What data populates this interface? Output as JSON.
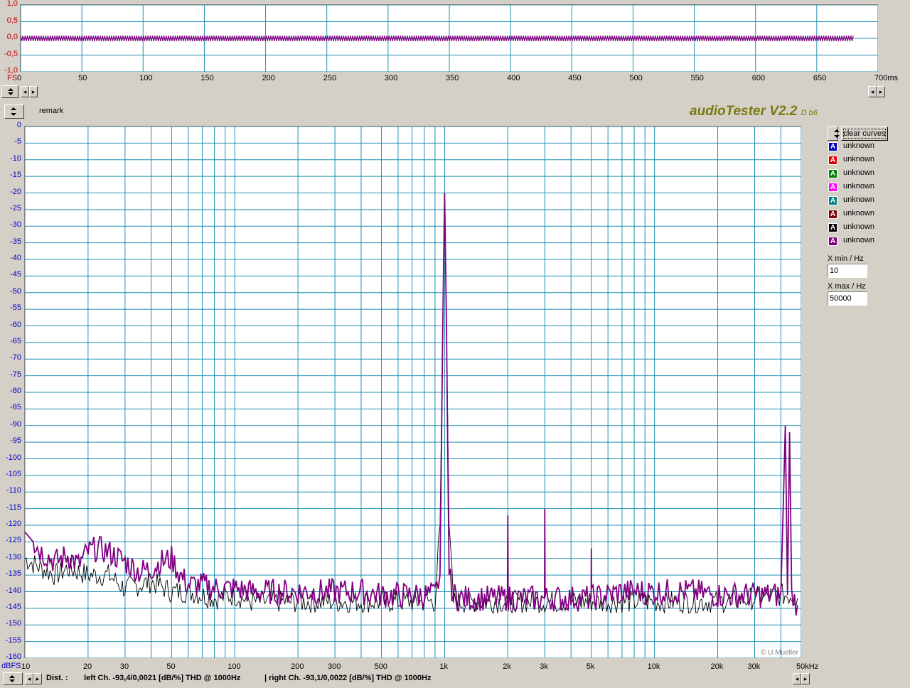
{
  "app": {
    "title": "audioTester V2.2",
    "version_suffix": "D b6",
    "remark": "remark",
    "copyright": "© U.Mueller",
    "clear_button": "clear curves"
  },
  "scope": {
    "y_ticks": [
      "1,0",
      "0,5",
      "0,0",
      "-0,5",
      "-1,0"
    ],
    "y_unit": "FS",
    "x_ticks": [
      "0",
      "50",
      "100",
      "150",
      "200",
      "250",
      "300",
      "350",
      "400",
      "450",
      "500",
      "550",
      "600",
      "650",
      "700ms"
    ]
  },
  "legend": {
    "items": [
      {
        "label": "unknown",
        "color": "#0000c0"
      },
      {
        "label": "unknown",
        "color": "#e00000"
      },
      {
        "label": "unknown",
        "color": "#008000"
      },
      {
        "label": "unknown",
        "color": "#ff00ff"
      },
      {
        "label": "unknown",
        "color": "#008080"
      },
      {
        "label": "unknown",
        "color": "#800000"
      },
      {
        "label": "unknown",
        "color": "#000000"
      },
      {
        "label": "unknown",
        "color": "#800080"
      }
    ],
    "swatch_glyph": "A"
  },
  "controls": {
    "xmin_label": "X min / Hz",
    "xmin_value": "10",
    "xmax_label": "X max / Hz",
    "xmax_value": "50000"
  },
  "status": {
    "dist_label": "Dist. :",
    "left": "left Ch. -93,4/0,0021 [dB/%] THD @ 1000Hz",
    "right": "| right Ch. -93,1/0,0022 [dB/%] THD @ 1000Hz"
  },
  "chart_data": [
    {
      "type": "line",
      "title": "",
      "xlabel": "ms",
      "ylabel": "FS",
      "xlim": [
        0,
        700
      ],
      "ylim": [
        -1,
        1
      ],
      "grid": true,
      "series": [
        {
          "color": "#800080",
          "x": [
            0,
            680
          ],
          "y": [
            0.0,
            0.0
          ],
          "amplitude": 0.08
        }
      ]
    },
    {
      "type": "line",
      "title": "",
      "xlabel": "kHz",
      "ylabel": "dBFS",
      "x_scale": "log",
      "xlim": [
        10,
        50000
      ],
      "ylim": [
        -160,
        0
      ],
      "grid": true,
      "y_ticks": [
        0,
        -5,
        -10,
        -15,
        -20,
        -25,
        -30,
        -35,
        -40,
        -45,
        -50,
        -55,
        -60,
        -65,
        -70,
        -75,
        -80,
        -85,
        -90,
        -95,
        -100,
        -105,
        -110,
        -115,
        -120,
        -125,
        -130,
        -135,
        -140,
        -145,
        -150,
        -155,
        -160
      ],
      "y_tick_labels": [
        "0",
        "-5",
        "-10",
        "-15",
        "-20",
        "-25",
        "-30",
        "-35",
        "-40",
        "-45",
        "-50",
        "-55",
        "-60",
        "-65",
        "-70",
        "-75",
        "-80",
        "-85",
        "-90",
        "-95",
        "-100",
        "-105",
        "-110",
        "-115",
        "-120",
        "-125",
        "-130",
        "-135",
        "-140",
        "-145",
        "-150",
        "-155",
        "-160"
      ],
      "y_unit": "dBFS",
      "x_ticks": [
        10,
        20,
        30,
        50,
        100,
        200,
        300,
        500,
        1000,
        2000,
        3000,
        5000,
        10000,
        20000,
        30000,
        50000
      ],
      "x_tick_labels": [
        "10",
        "20",
        "30",
        "50",
        "100",
        "200",
        "300",
        "500",
        "1k",
        "2k",
        "3k",
        "5k",
        "10k",
        "20k",
        "30k",
        "50kHz"
      ],
      "series": [
        {
          "color": "#000000",
          "x": [
            10,
            12,
            14,
            16,
            18,
            20,
            25,
            30,
            35,
            40,
            50,
            60,
            70,
            80,
            100,
            120,
            150,
            200,
            300,
            400,
            500,
            600,
            700,
            800,
            900,
            950,
            1000,
            1050,
            1100,
            1200,
            1500,
            2000,
            3000,
            4000,
            5000,
            7000,
            10000,
            15000,
            20000,
            30000,
            40000,
            45000,
            48000
          ],
          "y": [
            -130,
            -133,
            -135,
            -133,
            -134,
            -135,
            -135,
            -139,
            -138,
            -137,
            -140,
            -140,
            -141,
            -142,
            -141,
            -143,
            -143,
            -143,
            -143,
            -143,
            -143,
            -143,
            -143,
            -143,
            -143,
            -120,
            -20,
            -120,
            -143,
            -143,
            -143,
            -143,
            -143,
            -143,
            -143,
            -143,
            -143,
            -143,
            -143,
            -142,
            -141,
            -141,
            -142
          ]
        },
        {
          "color": "#800080",
          "x": [
            10,
            12,
            14,
            16,
            18,
            20,
            22,
            25,
            30,
            35,
            40,
            45,
            50,
            55,
            60,
            70,
            80,
            100,
            120,
            150,
            200,
            300,
            400,
            500,
            600,
            700,
            800,
            900,
            950,
            980,
            1000,
            1020,
            1050,
            1100,
            1200,
            1500,
            1990,
            2000,
            2010,
            2500,
            2990,
            3000,
            3010,
            4000,
            4990,
            5000,
            5010,
            7000,
            10000,
            15000,
            20000,
            30000,
            40000,
            42000,
            43000,
            44000,
            45000,
            48000
          ],
          "y": [
            -122,
            -128,
            -131,
            -129,
            -132,
            -128,
            -127,
            -128,
            -131,
            -134,
            -133,
            -131,
            -130,
            -135,
            -138,
            -138,
            -139,
            -139,
            -140,
            -140,
            -140,
            -140,
            -140,
            -141,
            -141,
            -141,
            -141,
            -141,
            -135,
            -60,
            -20,
            -60,
            -135,
            -141,
            -142,
            -142,
            -142,
            -117,
            -142,
            -142,
            -142,
            -115,
            -142,
            -142,
            -142,
            -127,
            -142,
            -140,
            -140,
            -140,
            -141,
            -141,
            -141,
            -90,
            -141,
            -92,
            -141,
            -144
          ]
        }
      ]
    }
  ]
}
